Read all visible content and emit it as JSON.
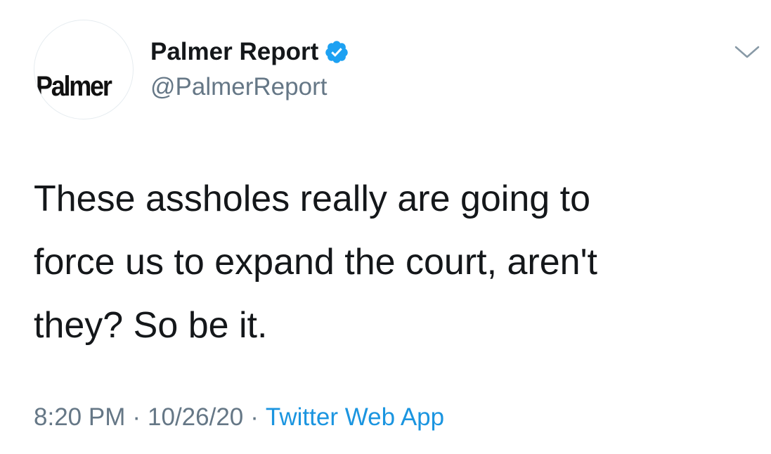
{
  "tweet": {
    "avatar_text": "Palmer",
    "display_name": "Palmer Report",
    "handle": "@PalmerReport",
    "verified_icon": "verified-badge-icon",
    "menu_icon": "chevron-down-icon",
    "text_lines": [
      "These assholes really are going to",
      "force us to expand the court, aren't",
      "they? So be it."
    ],
    "time": "8:20 PM",
    "separator": "·",
    "date": "10/26/20",
    "source": "Twitter Web App"
  },
  "colors": {
    "verified": "#1da1f2",
    "link": "#1b95e0",
    "secondary_text": "#657786",
    "primary_text": "#14171a",
    "background": "#ffffff"
  }
}
